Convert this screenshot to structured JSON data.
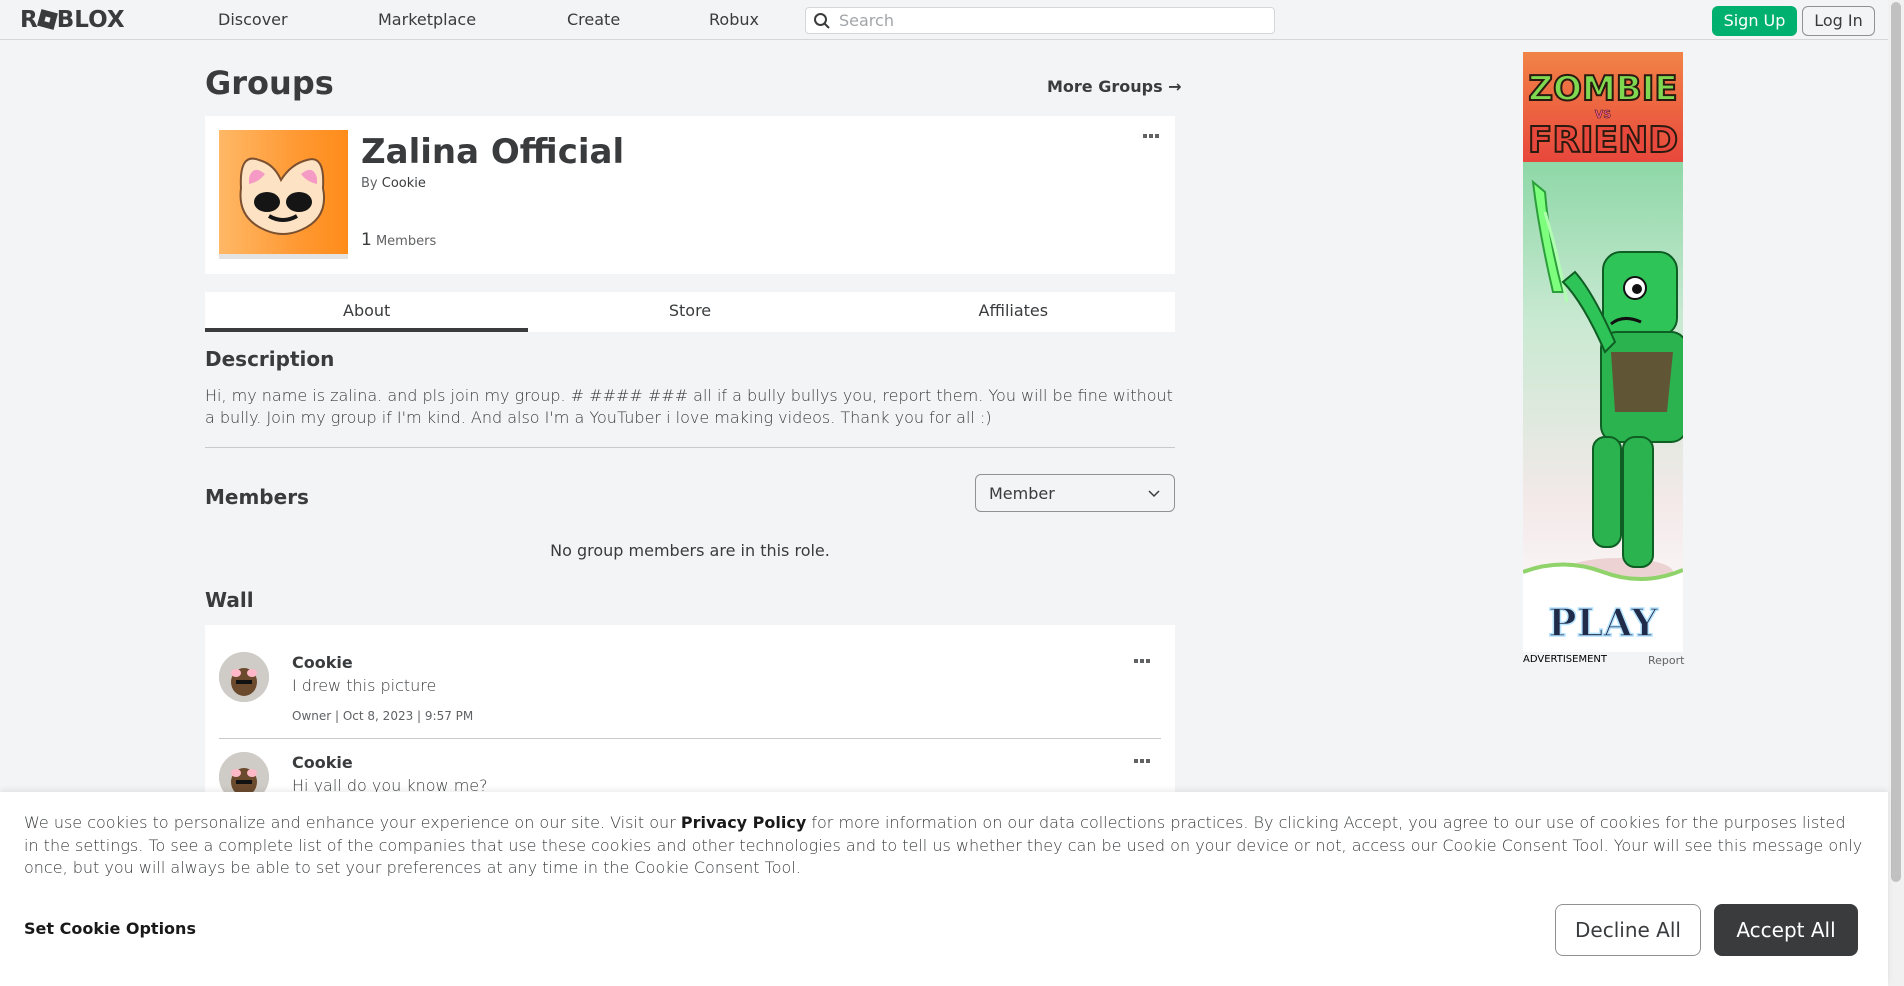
{
  "nav": {
    "logo": "ROBLOX",
    "links": [
      "Discover",
      "Marketplace",
      "Create",
      "Robux"
    ],
    "search_placeholder": "Search",
    "signup": "Sign Up",
    "login": "Log In"
  },
  "page": {
    "title": "Groups",
    "more_groups": "More Groups →"
  },
  "group": {
    "name": "Zalina Official",
    "by_label": "By",
    "owner": "Cookie",
    "members_count": "1",
    "members_label": "Members"
  },
  "tabs": [
    "About",
    "Store",
    "Affiliates"
  ],
  "about": {
    "description_title": "Description",
    "description": "Hi, my name is zalina. and pls join my group. # #### ### all if a bully bullys you, report them. You will be fine without a bully. Join my group if I'm kind. And also I'm a YouTuber i love making videos. Thank you for all :)",
    "members_title": "Members",
    "role_selected": "Member",
    "no_members": "No group members are in this role.",
    "wall_title": "Wall"
  },
  "wall": {
    "posts": [
      {
        "author": "Cookie",
        "body": "I drew this picture",
        "meta": "Owner | Oct 8, 2023 | 9:57 PM"
      },
      {
        "author": "Cookie",
        "body": "Hi yall do you know me?"
      }
    ]
  },
  "ad": {
    "title_line1": "ZOMBIE",
    "title_vs": "VS",
    "title_line2": "FRIEND",
    "cta": "PLAY",
    "label": "ADVERTISEMENT",
    "report": "Report"
  },
  "cookie": {
    "text_before": "We use cookies to personalize and enhance your experience on our site. Visit our ",
    "privacy_link": "Privacy Policy",
    "text_after": " for more information on our data collections practices. By clicking Accept, you agree to our use of cookies for the purposes listed in the settings. To see a complete list of the companies that use these cookies and other technologies and to tell us whether they can be used on your device or not, access our Cookie Consent Tool. Your will see this message only once, but you will always be able to set your preferences at any time in the Cookie Consent Tool.",
    "set_options": "Set Cookie Options",
    "decline": "Decline All",
    "accept": "Accept All"
  },
  "colors": {
    "accent_green": "#00b06f",
    "text_dark": "#393b3d",
    "page_bg": "#f2f4f5"
  }
}
